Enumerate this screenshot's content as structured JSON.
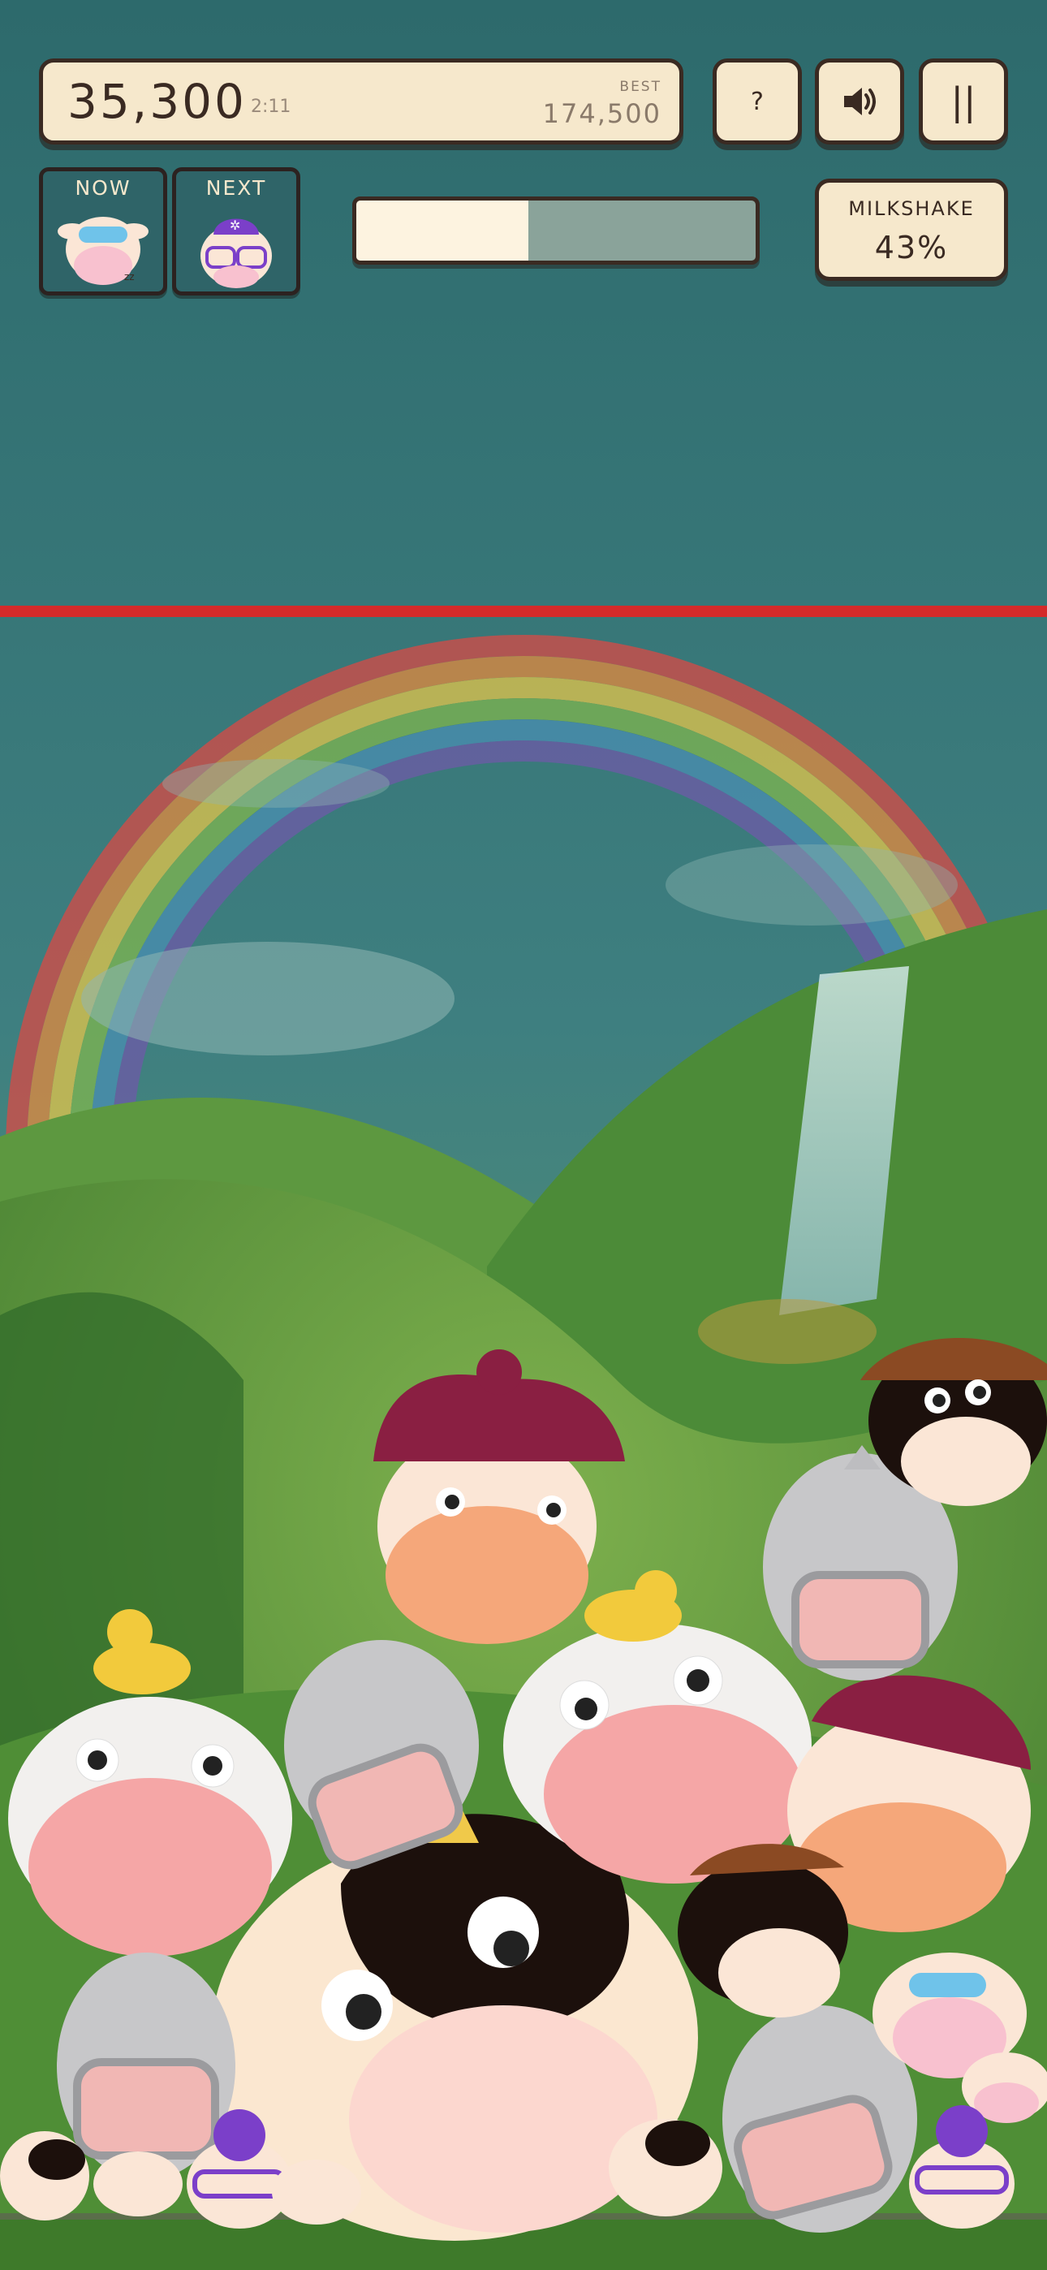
{
  "hud": {
    "score": "35,300",
    "time": "2:11",
    "best_label": "BEST",
    "best_value": "174,500",
    "help_label": "?",
    "pause_label": "||",
    "sound_icon": "speaker-icon"
  },
  "queue": {
    "now_label": "NOW",
    "now_piece": "sleeping-cow-piece",
    "next_label": "NEXT",
    "next_piece": "wizard-cow-piece"
  },
  "meter": {
    "label": "MILKSHAKE",
    "value_text": "43%",
    "fill_fraction": 0.43
  },
  "colors": {
    "panel": "#f6e8cc",
    "border": "#3a2a22",
    "danger_line": "#d42a2a"
  }
}
